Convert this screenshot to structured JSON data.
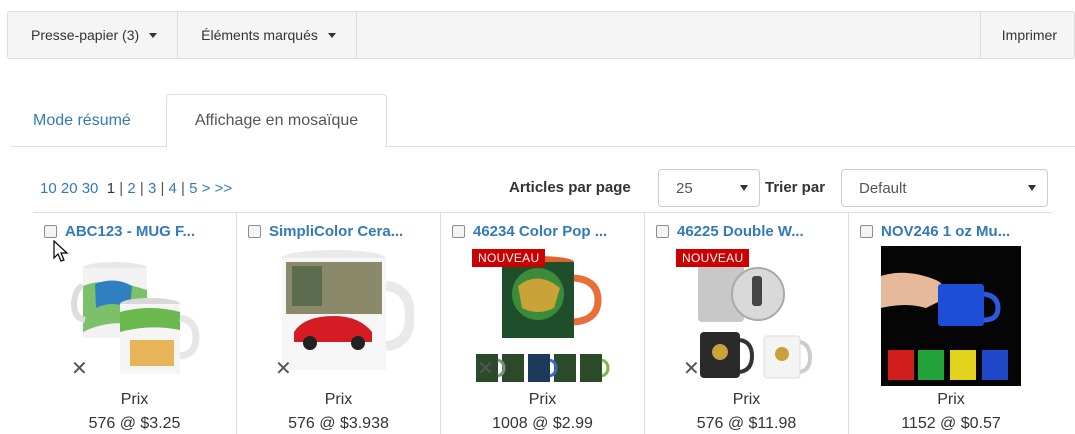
{
  "toolbar": {
    "clipboard_label": "Presse-papier (3)",
    "marked_label": "Éléments marqués",
    "print_label": "Imprimer"
  },
  "tabs": [
    {
      "label": "Mode résumé",
      "active": false
    },
    {
      "label": "Affichage en mosaïque",
      "active": true
    }
  ],
  "pager": {
    "sizes": [
      "10",
      "20",
      "30"
    ],
    "current": "1",
    "pages": [
      "2",
      "3",
      "4",
      "5"
    ],
    "next": ">",
    "last": ">>"
  },
  "per_page": {
    "label": "Articles par page",
    "value": "25"
  },
  "sort": {
    "label": "Trier par",
    "value": "Default"
  },
  "products": [
    {
      "title": "ABC123 - MUG  F...",
      "badge": "",
      "price_label": "Prix",
      "price": "576 @ $3.25",
      "logo": true
    },
    {
      "title": "SimpliColor Cera...",
      "badge": "",
      "price_label": "Prix",
      "price": "576 @ $3.938",
      "logo": true
    },
    {
      "title": "46234  Color Pop ...",
      "badge": "NOUVEAU",
      "price_label": "Prix",
      "price": "1008 @ $2.99",
      "logo": true
    },
    {
      "title": "46225  Double W...",
      "badge": "NOUVEAU",
      "price_label": "Prix",
      "price": "576 @ $11.98",
      "logo": true
    },
    {
      "title": "NOV246  1 oz Mu...",
      "badge": "",
      "price_label": "Prix",
      "price": "1152 @ $0.57",
      "logo": false
    }
  ],
  "colors": {
    "link": "#337ab7",
    "badge": "#cc0000",
    "border": "#dddddd"
  }
}
